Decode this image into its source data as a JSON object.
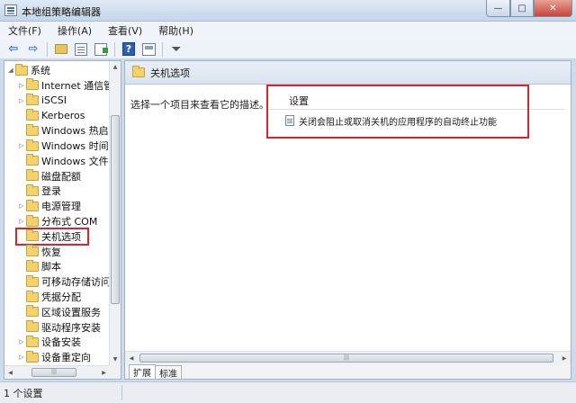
{
  "window": {
    "title": "本地组策略编辑器",
    "min_glyph": "—",
    "max_glyph": "□",
    "close_glyph": "✕"
  },
  "menu": [
    "文件(F)",
    "操作(A)",
    "查看(V)",
    "帮助(H)"
  ],
  "toolbar": {
    "back_glyph": "⇦",
    "forward_glyph": "⇨",
    "help_glyph": "?",
    "filter_glyph": "⏷"
  },
  "tree": {
    "items": [
      {
        "label": "系统",
        "expander": "◢",
        "indent": 0
      },
      {
        "label": "Internet 通信管",
        "expander": "▷",
        "indent": 1
      },
      {
        "label": "iSCSI",
        "expander": "▷",
        "indent": 1
      },
      {
        "label": "Kerberos",
        "expander": "",
        "indent": 1
      },
      {
        "label": "Windows 热启动",
        "expander": "",
        "indent": 1
      },
      {
        "label": "Windows 时间服",
        "expander": "▷",
        "indent": 1
      },
      {
        "label": "Windows 文件保",
        "expander": "",
        "indent": 1
      },
      {
        "label": "磁盘配额",
        "expander": "",
        "indent": 1
      },
      {
        "label": "登录",
        "expander": "",
        "indent": 1
      },
      {
        "label": "电源管理",
        "expander": "▷",
        "indent": 1
      },
      {
        "label": "分布式 COM",
        "expander": "▷",
        "indent": 1
      },
      {
        "label": "关机选项",
        "expander": "",
        "indent": 1,
        "selected": true
      },
      {
        "label": "恢复",
        "expander": "",
        "indent": 1
      },
      {
        "label": "脚本",
        "expander": "",
        "indent": 1
      },
      {
        "label": "可移动存储访问",
        "expander": "",
        "indent": 1
      },
      {
        "label": "凭据分配",
        "expander": "",
        "indent": 1
      },
      {
        "label": "区域设置服务",
        "expander": "",
        "indent": 1
      },
      {
        "label": "驱动程序安装",
        "expander": "",
        "indent": 1
      },
      {
        "label": "设备安装",
        "expander": "▷",
        "indent": 1
      },
      {
        "label": "设备重定向",
        "expander": "▷",
        "indent": 1
      }
    ],
    "scroll_up": "▲",
    "scroll_down": "▼",
    "scroll_left": "◀",
    "scroll_right": "▶",
    "grip": "|||"
  },
  "details": {
    "header_title": "关机选项",
    "description": "选择一个项目来查看它的描述。",
    "column_header": "设置",
    "settings": [
      "关闭会阻止或取消关机的应用程序的自动终止功能"
    ],
    "tabs": [
      "扩展",
      "标准"
    ],
    "active_tab": "扩展"
  },
  "status": {
    "text": "1 个设置"
  },
  "colors": {
    "highlight_red": "#d6262b",
    "folder_yellow": "#f3d26d"
  }
}
